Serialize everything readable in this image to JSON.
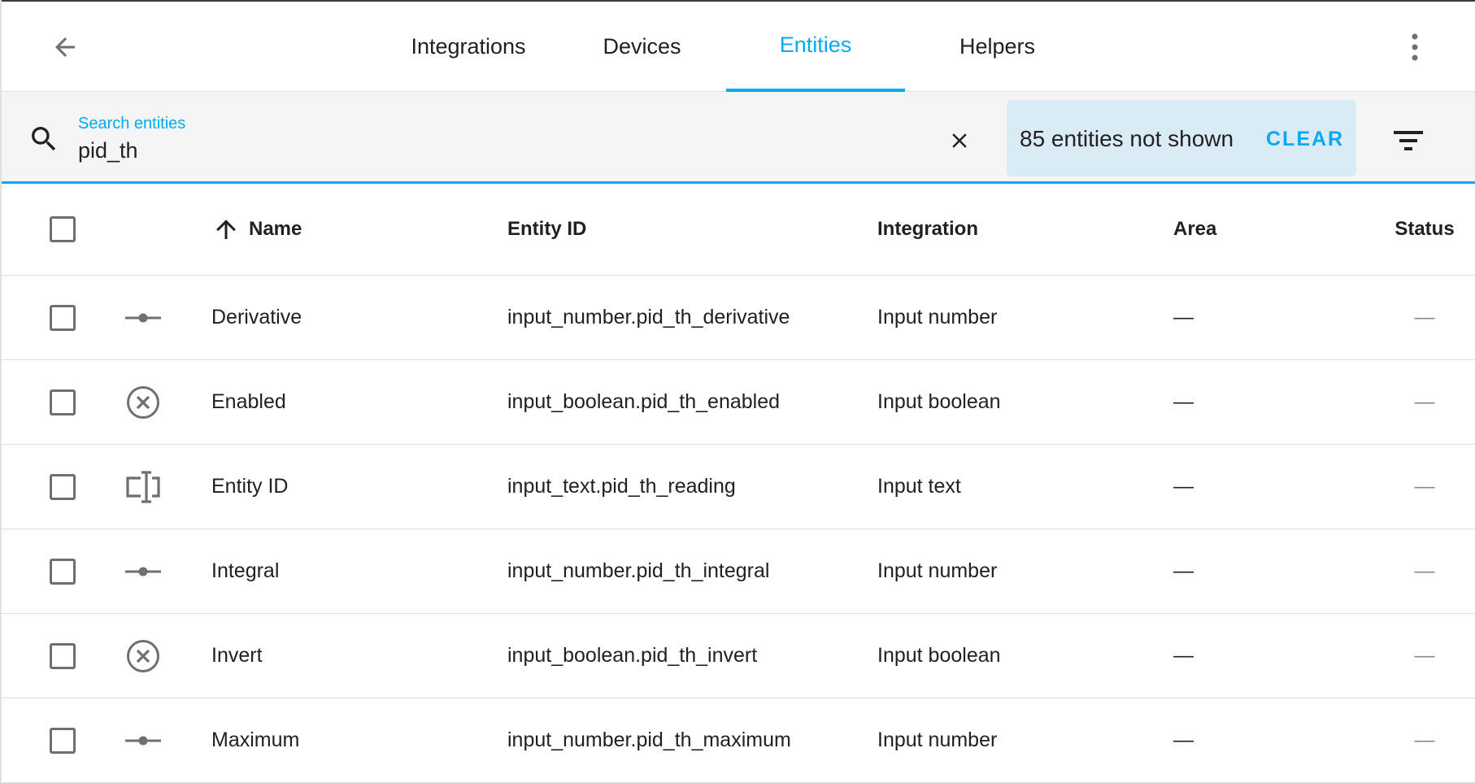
{
  "header": {
    "tabs": [
      {
        "label": "Integrations",
        "active": false
      },
      {
        "label": "Devices",
        "active": false
      },
      {
        "label": "Entities",
        "active": true
      },
      {
        "label": "Helpers",
        "active": false
      }
    ]
  },
  "search": {
    "label": "Search entities",
    "value": "pid_th"
  },
  "filter_notice": {
    "text": "85 entities not shown",
    "clear_label": "CLEAR"
  },
  "table": {
    "columns": {
      "name": "Name",
      "entity_id": "Entity ID",
      "integration": "Integration",
      "area": "Area",
      "status": "Status"
    },
    "rows": [
      {
        "icon": "slider-icon",
        "name": "Derivative",
        "entity_id": "input_number.pid_th_derivative",
        "integration": "Input number",
        "area": "—",
        "status": "—"
      },
      {
        "icon": "close-circle-icon",
        "name": "Enabled",
        "entity_id": "input_boolean.pid_th_enabled",
        "integration": "Input boolean",
        "area": "—",
        "status": "—"
      },
      {
        "icon": "textbox-icon",
        "name": "Entity ID",
        "entity_id": "input_text.pid_th_reading",
        "integration": "Input text",
        "area": "—",
        "status": "—"
      },
      {
        "icon": "slider-icon",
        "name": "Integral",
        "entity_id": "input_number.pid_th_integral",
        "integration": "Input number",
        "area": "—",
        "status": "—"
      },
      {
        "icon": "close-circle-icon",
        "name": "Invert",
        "entity_id": "input_boolean.pid_th_invert",
        "integration": "Input boolean",
        "area": "—",
        "status": "—"
      },
      {
        "icon": "slider-icon",
        "name": "Maximum",
        "entity_id": "input_number.pid_th_maximum",
        "integration": "Input number",
        "area": "—",
        "status": "—"
      }
    ]
  },
  "colors": {
    "accent": "#03a9f4",
    "notice_bg": "#d9ecf5",
    "icon": "#6f6f6f"
  }
}
